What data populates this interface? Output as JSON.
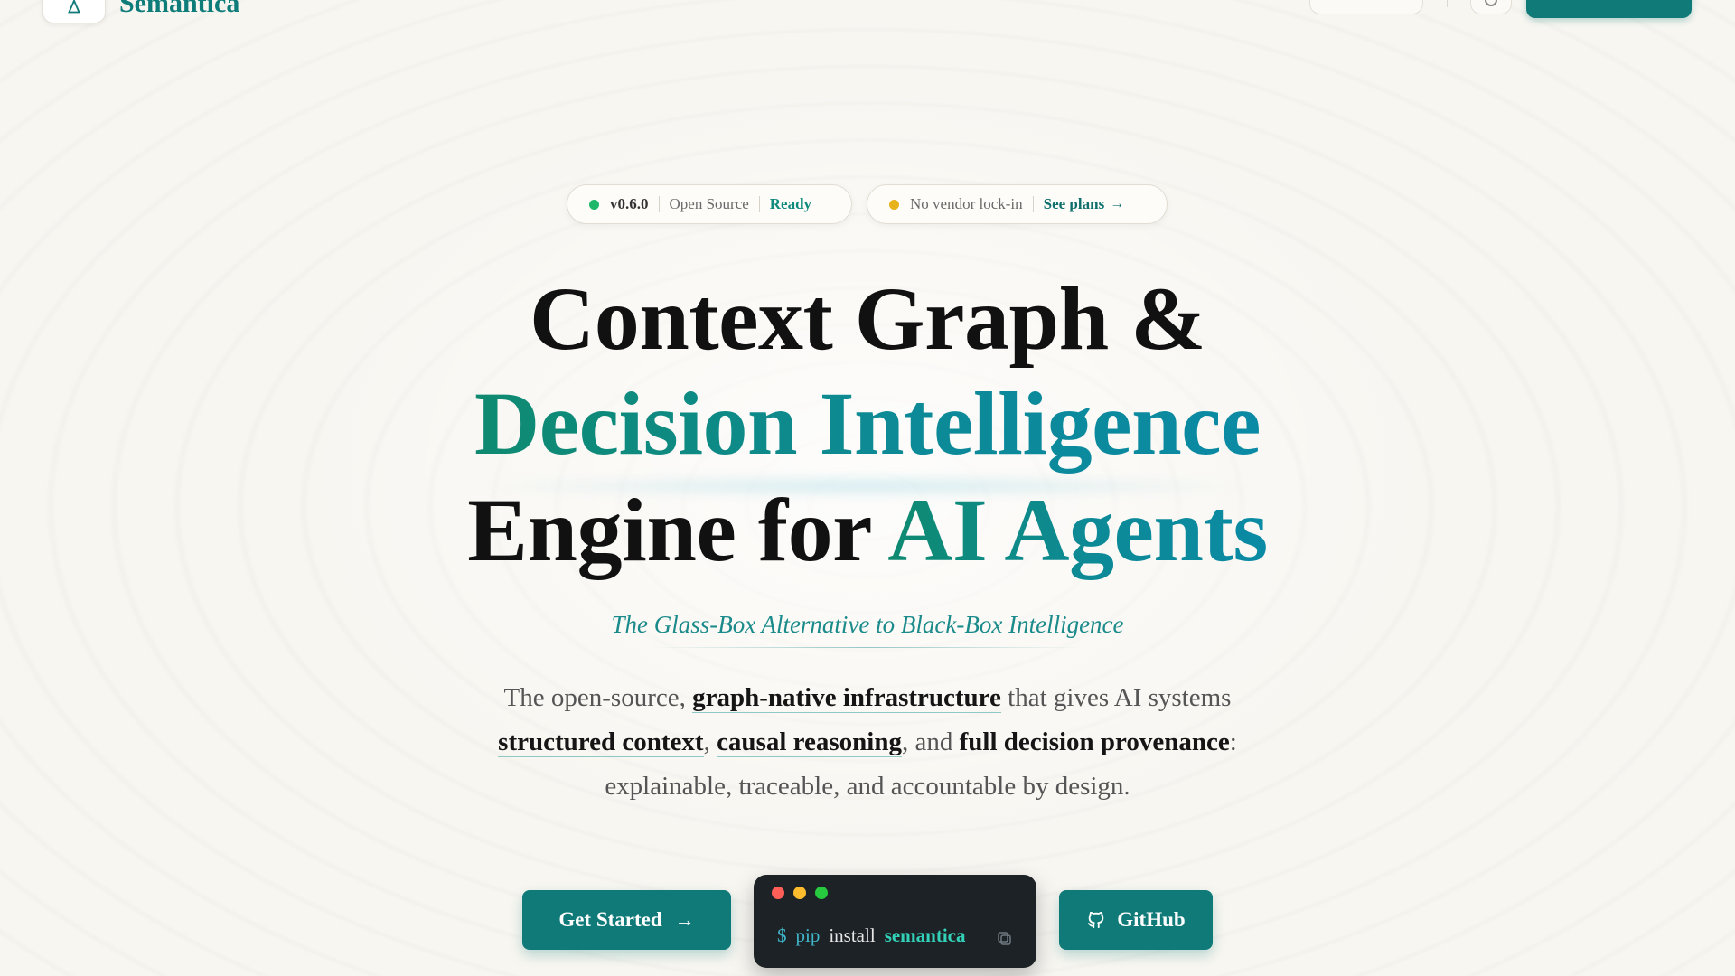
{
  "nav": {
    "brand": "Semantica",
    "links": [
      "",
      "",
      "",
      ""
    ],
    "cta_label": ""
  },
  "badges": {
    "left": {
      "version": "v0.6.0",
      "license": "Open Source",
      "status": "Ready"
    },
    "right": {
      "text": "No vendor lock-in",
      "link": "See plans",
      "arrow": "→"
    }
  },
  "hero": {
    "line1": "Context Graph &",
    "line2": "Decision Intelligence",
    "line3_plain": "Engine for ",
    "line3_accent": "AI Agents",
    "tagline": "The Glass-Box Alternative to Black-Box Intelligence",
    "para": {
      "p1": "The open-source, ",
      "b1": "graph-native infrastructure",
      "p2": " that gives AI systems ",
      "b2": "structured context",
      "p3": ", ",
      "b3": "causal reasoning",
      "p4": ", and ",
      "b4": "full decision provenance",
      "p5": ": explainable, traceable, and accountable by design."
    }
  },
  "cta": {
    "get_started": "Get Started",
    "arrow": "→",
    "terminal": {
      "prompt": "$",
      "cmd": "pip",
      "verb": "install",
      "package": "semantica"
    },
    "github": "GitHub"
  },
  "colors": {
    "accent": "#0f7a78",
    "status_green": "#1fb86b",
    "status_amber": "#e8b21b",
    "background": "#f8f6f1"
  },
  "icons": [
    "logo-icon",
    "theme-toggle-icon",
    "arrow-right-icon",
    "copy-icon",
    "github-icon"
  ]
}
